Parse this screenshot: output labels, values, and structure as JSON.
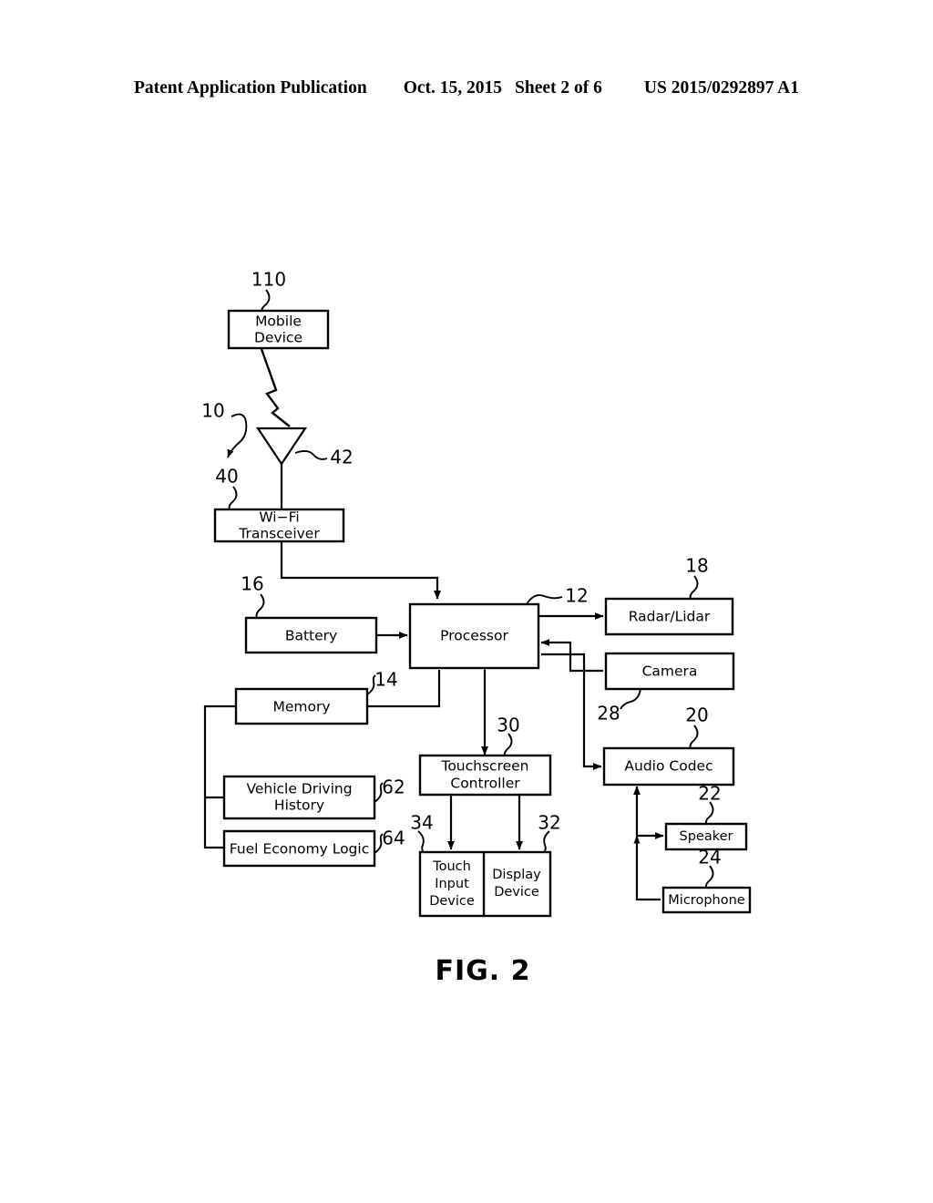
{
  "header": {
    "publication": "Patent Application Publication",
    "date": "Oct. 15, 2015",
    "sheet": "Sheet 2 of 6",
    "number": "US 2015/0292897 A1"
  },
  "figure": {
    "caption": "FIG. 2",
    "system_ref": "10"
  },
  "blocks": [
    {
      "id": "mobile-device",
      "label_line1": "Mobile",
      "label_line2": "Device",
      "ref": "110"
    },
    {
      "id": "antenna",
      "label_line1": "",
      "label_line2": "",
      "ref": "42"
    },
    {
      "id": "wifi-transceiver",
      "label_line1": "Wi−Fi",
      "label_line2": "Transceiver",
      "ref": "40"
    },
    {
      "id": "battery",
      "label_line1": "Battery",
      "label_line2": "",
      "ref": "16"
    },
    {
      "id": "processor",
      "label_line1": "Processor",
      "label_line2": "",
      "ref": "12"
    },
    {
      "id": "memory",
      "label_line1": "Memory",
      "label_line2": "",
      "ref": "14"
    },
    {
      "id": "vehicle-driving-history",
      "label_line1": "Vehicle  Driving",
      "label_line2": "History",
      "ref": "62"
    },
    {
      "id": "fuel-economy-logic",
      "label_line1": "Fuel  Economy  Logic",
      "label_line2": "",
      "ref": "64"
    },
    {
      "id": "radar-lidar",
      "label_line1": "Radar/Lidar",
      "label_line2": "",
      "ref": "18"
    },
    {
      "id": "camera",
      "label_line1": "Camera",
      "label_line2": "",
      "ref": "28"
    },
    {
      "id": "audio-codec",
      "label_line1": "Audio  Codec",
      "label_line2": "",
      "ref": "20"
    },
    {
      "id": "speaker",
      "label_line1": "Speaker",
      "label_line2": "",
      "ref": "22"
    },
    {
      "id": "microphone",
      "label_line1": "Microphone",
      "label_line2": "",
      "ref": "24"
    },
    {
      "id": "touchscreen-controller",
      "label_line1": "Touchscreen",
      "label_line2": "Controller",
      "ref": "30"
    },
    {
      "id": "touch-input-device",
      "label_line1": "Touch",
      "label_line2": "Input",
      "label_line3": "Device",
      "ref": "34"
    },
    {
      "id": "display-device",
      "label_line1": "Display",
      "label_line2": "Device",
      "ref": "32"
    }
  ]
}
